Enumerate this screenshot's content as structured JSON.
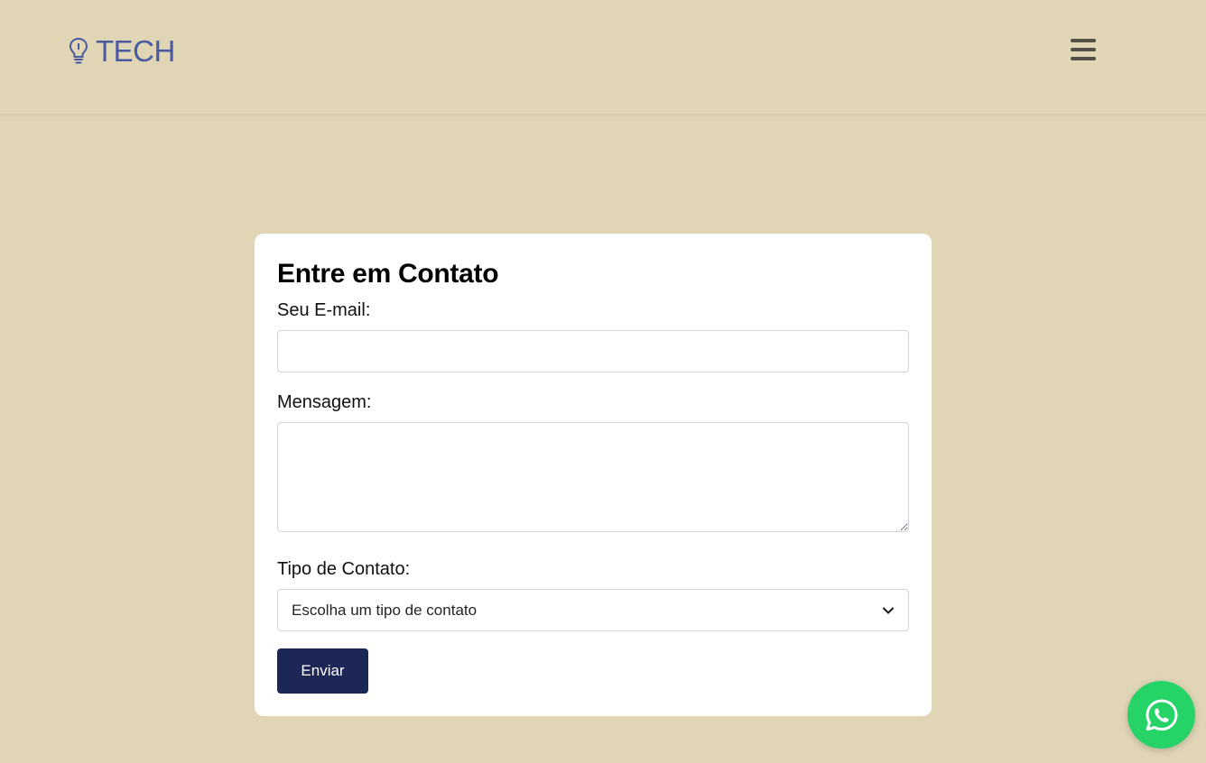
{
  "header": {
    "logo_text": "TECH",
    "logo_icon": "lightbulb-icon",
    "menu_icon": "hamburger-menu-icon"
  },
  "contact_form": {
    "title": "Entre em Contato",
    "email_label": "Seu E-mail:",
    "email_value": "",
    "message_label": "Mensagem:",
    "message_value": "",
    "contact_type_label": "Tipo de Contato:",
    "contact_type_selected": "Escolha um tipo de contato",
    "submit_label": "Enviar"
  },
  "floating": {
    "whatsapp_icon": "whatsapp-icon"
  },
  "colors": {
    "background": "#e0d6b6",
    "logo": "#4a5aa0",
    "submit_button": "#1c2657",
    "whatsapp": "#25d366"
  }
}
